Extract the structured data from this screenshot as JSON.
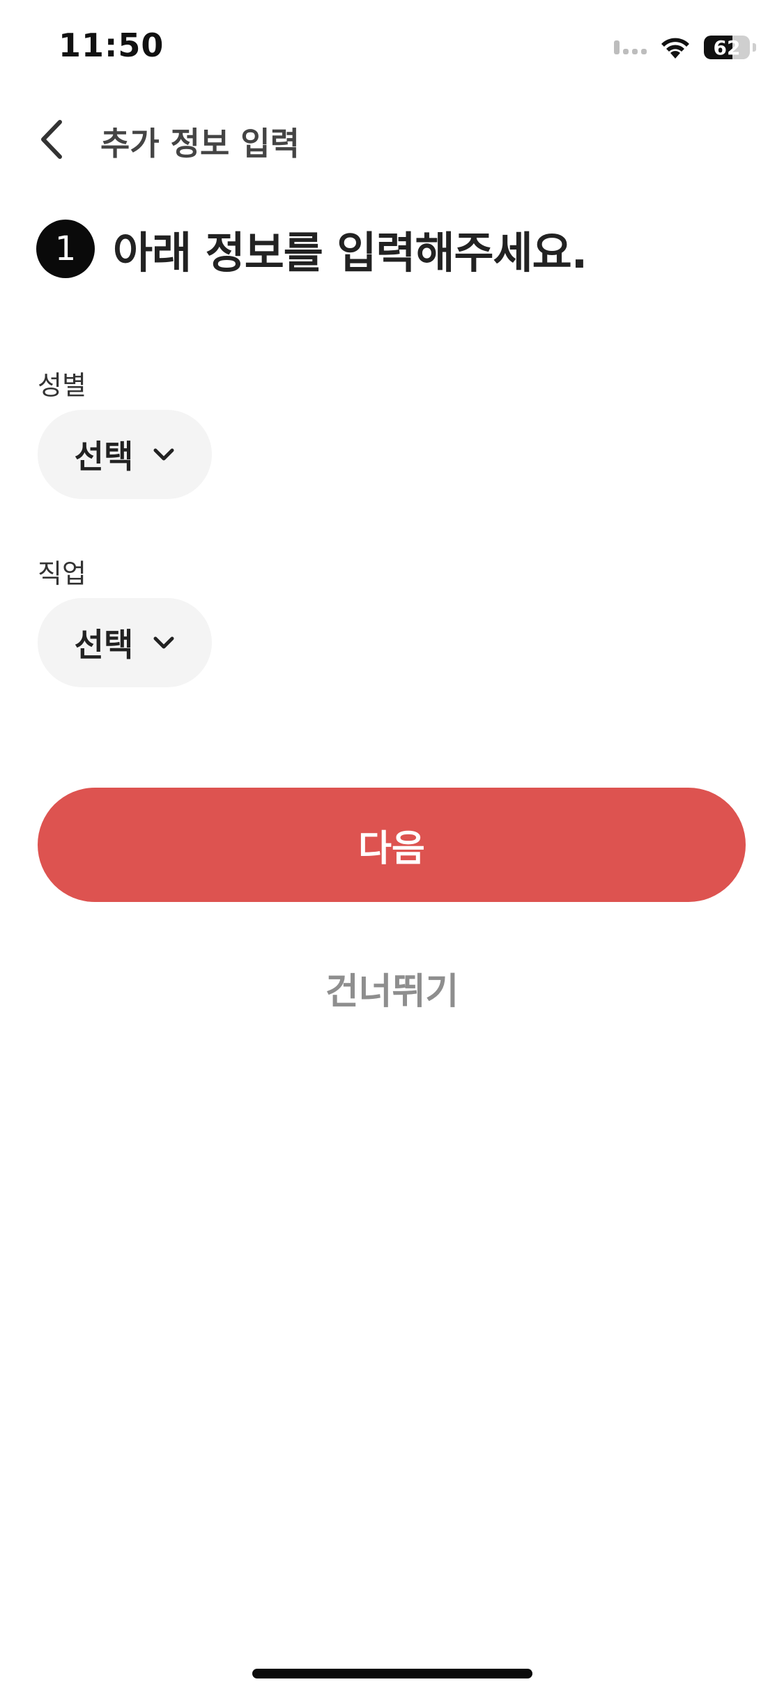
{
  "status_bar": {
    "time": "11:50",
    "battery_level": "62",
    "battery_fraction": 0.62
  },
  "header": {
    "title": "추가 정보 입력",
    "back_icon": "chevron-left-icon"
  },
  "step": {
    "number": "1",
    "title": "아래 정보를 입력해주세요."
  },
  "fields": {
    "gender": {
      "label": "성별",
      "value": "선택"
    },
    "job": {
      "label": "직업",
      "value": "선택"
    }
  },
  "actions": {
    "next_label": "다음",
    "skip_label": "건너뛰기"
  },
  "colors": {
    "primary": "#dd5350",
    "pill_bg": "#f4f4f4",
    "muted_text": "#8e8e8e"
  }
}
